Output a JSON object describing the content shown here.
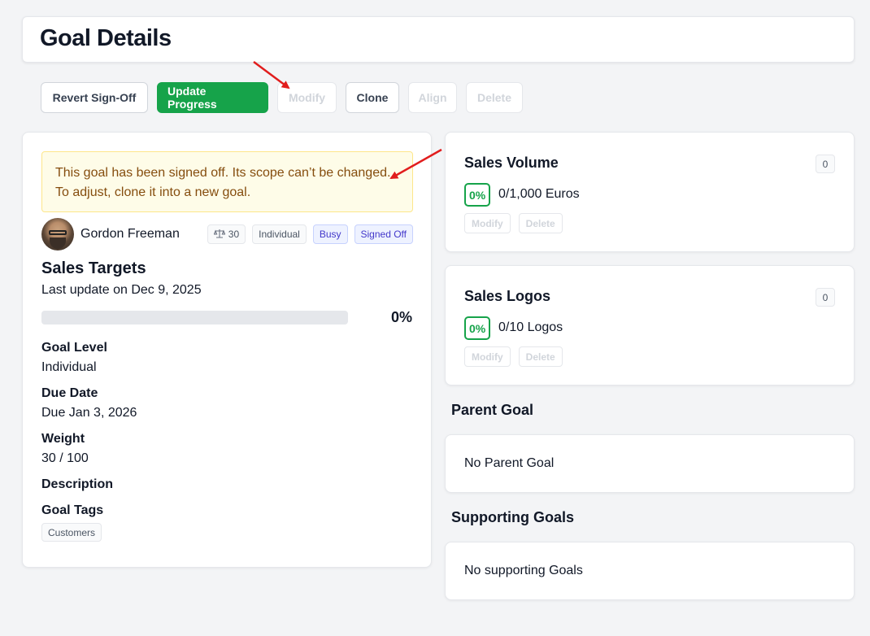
{
  "page": {
    "title": "Goal Details"
  },
  "toolbar": {
    "revert_label": "Revert Sign-Off",
    "update_label": "Update Progress",
    "modify_label": "Modify",
    "clone_label": "Clone",
    "align_label": "Align",
    "delete_label": "Delete"
  },
  "notice": {
    "text": "This goal has been signed off. Its scope can’t be changed. To adjust, clone it into a new goal."
  },
  "owner": {
    "name": "Gordon Freeman"
  },
  "chips": {
    "weight": "30",
    "level": "Individual",
    "status": "Busy",
    "signoff": "Signed Off"
  },
  "goal": {
    "title": "Sales Targets",
    "updated": "Last update on Dec 9, 2025",
    "progress_pct_label": "0%",
    "progress_fraction": 0
  },
  "fields": {
    "level_label": "Goal Level",
    "level_value": "Individual",
    "due_label": "Due Date",
    "due_value": "Due Jan 3, 2026",
    "weight_label": "Weight",
    "weight_value": "30 / 100",
    "description_label": "Description",
    "tags_label": "Goal Tags",
    "tags": [
      "Customers"
    ]
  },
  "key_results": [
    {
      "title": "Sales Volume",
      "count": "0",
      "pct": "0%",
      "value": "0/1,000 Euros",
      "modify": "Modify",
      "delete": "Delete"
    },
    {
      "title": "Sales Logos",
      "count": "0",
      "pct": "0%",
      "value": "0/10 Logos",
      "modify": "Modify",
      "delete": "Delete"
    }
  ],
  "parent_goal": {
    "heading": "Parent Goal",
    "empty_text": "No Parent Goal"
  },
  "supporting_goals": {
    "heading": "Supporting Goals",
    "empty_text": "No supporting Goals"
  },
  "colors": {
    "primary": "#16a34a",
    "notice_bg": "#fefce8",
    "notice_text": "#854d0e",
    "annotation_arrow": "#e11d1d"
  }
}
